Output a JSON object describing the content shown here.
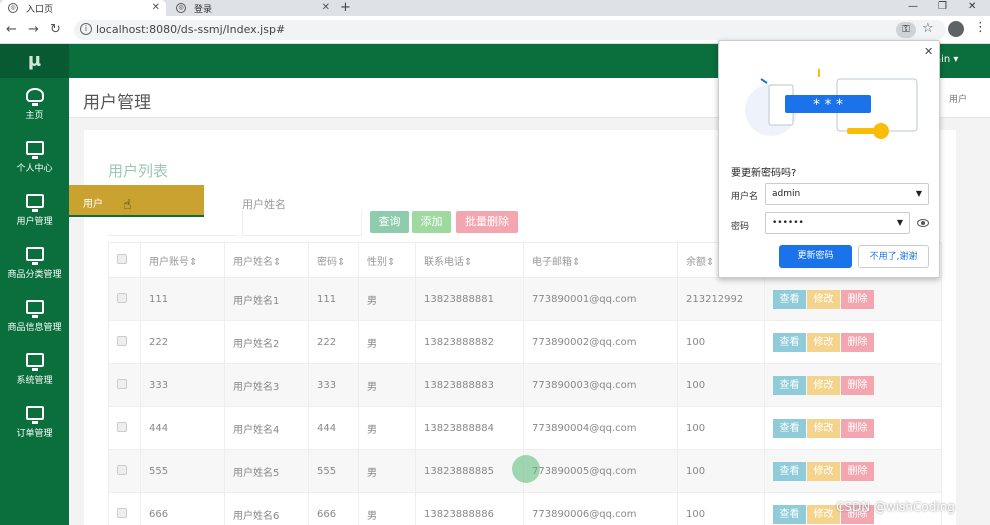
{
  "browser": {
    "tabs": [
      {
        "title": "入口页",
        "active": true
      },
      {
        "title": "登录",
        "active": false
      }
    ],
    "url": "localhost:8080/ds-ssmj/Index.jsp#"
  },
  "app": {
    "logo": "μ",
    "user_menu": "ain ▾",
    "page_title": "用户管理",
    "breadcrumb": "用户",
    "sidebar": [
      {
        "label": "主页",
        "icon": "dashboard-icon"
      },
      {
        "label": "个人中心",
        "icon": "monitor-icon"
      },
      {
        "label": "用户管理",
        "icon": "monitor-icon"
      },
      {
        "label": "商品分类管理",
        "icon": "monitor-icon"
      },
      {
        "label": "商品信息管理",
        "icon": "monitor-icon"
      },
      {
        "label": "系统管理",
        "icon": "monitor-icon"
      },
      {
        "label": "订单管理",
        "icon": "monitor-icon"
      }
    ],
    "submenu_item": "用户"
  },
  "panel": {
    "title": "用户列表",
    "search_label": "用户姓名",
    "buttons": {
      "query": "查询",
      "add": "添加",
      "batch_delete": "批量删除"
    }
  },
  "table": {
    "headers": [
      "用户账号",
      "用户姓名",
      "密码",
      "性别",
      "联系电话",
      "电子邮箱",
      "余额"
    ],
    "rows": [
      [
        "111",
        "用户姓名1",
        "111",
        "男",
        "13823888881",
        "773890001@qq.com",
        "213212992"
      ],
      [
        "222",
        "用户姓名2",
        "222",
        "男",
        "13823888882",
        "773890002@qq.com",
        "100"
      ],
      [
        "333",
        "用户姓名3",
        "333",
        "男",
        "13823888883",
        "773890003@qq.com",
        "100"
      ],
      [
        "444",
        "用户姓名4",
        "444",
        "男",
        "13823888884",
        "773890004@qq.com",
        "100"
      ],
      [
        "555",
        "用户姓名5",
        "555",
        "男",
        "13823888885",
        "773890005@qq.com",
        "100"
      ],
      [
        "666",
        "用户姓名6",
        "666",
        "男",
        "13823888886",
        "773890006@qq.com",
        "100"
      ]
    ],
    "actions": {
      "view": "查看",
      "edit": "修改",
      "delete": "删除"
    }
  },
  "password_popup": {
    "title": "要更新密码吗?",
    "username_label": "用户名",
    "username_value": "admin",
    "password_label": "密码",
    "password_value": "••••••",
    "stars": "* * *",
    "primary_button": "更新密码",
    "secondary_button": "不用了,谢谢"
  },
  "watermark": "CSDN @wishCoding",
  "colors": {
    "sidebar": "#0a6e3d",
    "submenu": "#c9a230",
    "primary": "#1a73e8"
  }
}
